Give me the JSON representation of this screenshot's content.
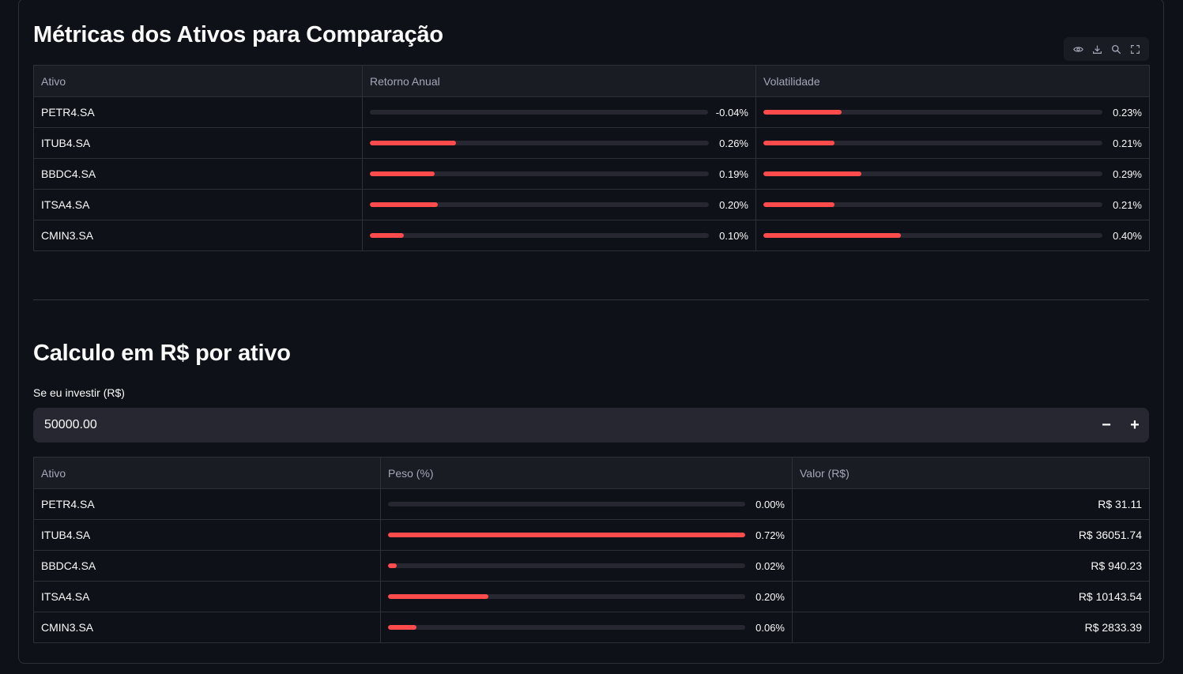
{
  "section1": {
    "title": "Métricas dos Ativos para Comparação",
    "columns": [
      "Ativo",
      "Retorno Anual",
      "Volatilidade"
    ],
    "rows": [
      {
        "ativo": "PETR4.SA",
        "retorno": "-0.04%",
        "retorno_fill": 0.0,
        "vol": "0.23%",
        "vol_fill": 0.23
      },
      {
        "ativo": "ITUB4.SA",
        "retorno": "0.26%",
        "retorno_fill": 0.255,
        "vol": "0.21%",
        "vol_fill": 0.21
      },
      {
        "ativo": "BBDC4.SA",
        "retorno": "0.19%",
        "retorno_fill": 0.19,
        "vol": "0.29%",
        "vol_fill": 0.29
      },
      {
        "ativo": "ITSA4.SA",
        "retorno": "0.20%",
        "retorno_fill": 0.2,
        "vol": "0.21%",
        "vol_fill": 0.21
      },
      {
        "ativo": "CMIN3.SA",
        "retorno": "0.10%",
        "retorno_fill": 0.1,
        "vol": "0.40%",
        "vol_fill": 0.405
      }
    ]
  },
  "toolbar": {
    "icons": [
      "eye-icon",
      "download-icon",
      "search-icon",
      "fullscreen-icon"
    ]
  },
  "section2": {
    "title": "Calculo em R$ por ativo",
    "input_label": "Se eu investir (R$)",
    "input_value": "50000.00",
    "minus": "−",
    "plus": "+",
    "columns": [
      "Ativo",
      "Peso (%)",
      "Valor (R$)"
    ],
    "rows": [
      {
        "ativo": "PETR4.SA",
        "peso": "0.00%",
        "peso_fill": 0.0,
        "valor": "R$ 31.11"
      },
      {
        "ativo": "ITUB4.SA",
        "peso": "0.72%",
        "peso_fill": 1.0,
        "valor": "R$ 36051.74"
      },
      {
        "ativo": "BBDC4.SA",
        "peso": "0.02%",
        "peso_fill": 0.025,
        "valor": "R$ 940.23"
      },
      {
        "ativo": "ITSA4.SA",
        "peso": "0.20%",
        "peso_fill": 0.28,
        "valor": "R$ 10143.54"
      },
      {
        "ativo": "CMIN3.SA",
        "peso": "0.06%",
        "peso_fill": 0.08,
        "valor": "R$ 2833.39"
      }
    ]
  },
  "colors": {
    "accent": "#ff4b4b",
    "background": "#0e1117",
    "track": "#262730"
  }
}
